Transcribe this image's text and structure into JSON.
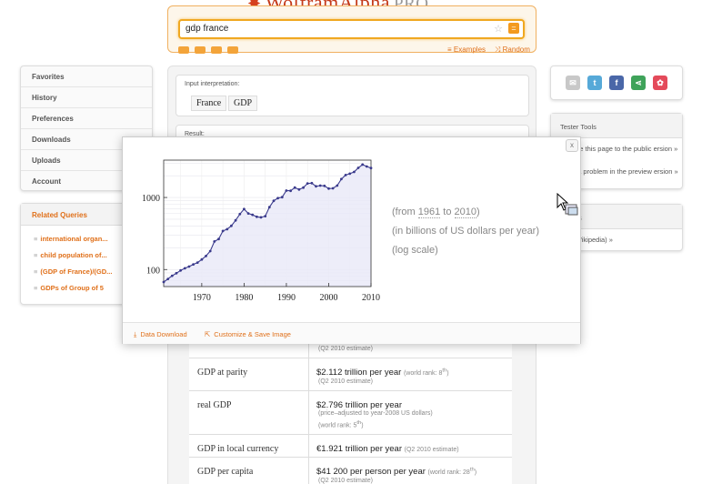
{
  "header": {
    "logo_text": "WolframAlpha",
    "logo_pro": "PRO",
    "search_value": "gdp france",
    "examples_label": "Examples",
    "random_label": "Random"
  },
  "left_nav": {
    "items": [
      "Favorites",
      "History",
      "Preferences",
      "Downloads",
      "Uploads",
      "Account"
    ]
  },
  "related_queries": {
    "title": "Related Queries",
    "items": [
      "international organ...",
      "child population of...",
      "(GDP of France)/(GD...",
      "GDPs of Group of 5"
    ]
  },
  "input_interpretation": {
    "label": "Input interpretation:",
    "parts": [
      "France",
      "GDP"
    ]
  },
  "result": {
    "label": "Result:"
  },
  "popup": {
    "close_label": "x",
    "notes": [
      "(from ",
      "1961",
      " to ",
      "2010",
      ")"
    ],
    "note_units": "(in billions of US dollars per year)",
    "note_scale": "(log scale)",
    "data_download_label": "Data Download",
    "customize_label": "Customize & Save Image"
  },
  "chart_data": {
    "type": "line",
    "title": "",
    "xlabel": "",
    "ylabel": "",
    "yscale": "log",
    "xlim": [
      1961,
      2010
    ],
    "ylim": [
      58,
      3300
    ],
    "x_ticks": [
      1970,
      1980,
      1990,
      2000,
      2010
    ],
    "y_ticks": [
      100,
      1000
    ],
    "grid": true,
    "x": [
      1961,
      1962,
      1963,
      1964,
      1965,
      1966,
      1967,
      1968,
      1969,
      1970,
      1971,
      1972,
      1973,
      1974,
      1975,
      1976,
      1977,
      1978,
      1979,
      1980,
      1981,
      1982,
      1983,
      1984,
      1985,
      1986,
      1987,
      1988,
      1989,
      1990,
      1991,
      1992,
      1993,
      1994,
      1995,
      1996,
      1997,
      1998,
      1999,
      2000,
      2001,
      2002,
      2003,
      2004,
      2005,
      2006,
      2007,
      2008,
      2009,
      2010
    ],
    "values": [
      67,
      74,
      82,
      89,
      97,
      104,
      110,
      118,
      125,
      138,
      154,
      180,
      245,
      265,
      343,
      363,
      404,
      482,
      589,
      690,
      600,
      575,
      540,
      530,
      550,
      735,
      900,
      980,
      1010,
      1245,
      1240,
      1370,
      1290,
      1370,
      1570,
      1580,
      1430,
      1460,
      1450,
      1330,
      1340,
      1460,
      1800,
      2050,
      2140,
      2260,
      2580,
      2860,
      2690,
      2560
    ]
  },
  "table": {
    "rows": [
      {
        "key": "",
        "value": "",
        "sub": "(Q2 2010 estimate)"
      },
      {
        "key": "GDP at parity",
        "value": "$2.112 trillion per year",
        "rank": "(world rank: 8",
        "rank_sup": "th",
        "rank_end": ")",
        "sub": "(Q2 2010 estimate)"
      },
      {
        "key": "real GDP",
        "value": "$2.796 trillion per year",
        "sub": "(price–adjusted to year-2008 US dollars)",
        "sub2": "(world rank: 5",
        "sub2_sup": "th",
        "sub2_end": ")"
      },
      {
        "key": "GDP in local currency",
        "value": "€1.921 trillion per year",
        "rank": "(Q2 2010 estimate)"
      },
      {
        "key": "GDP per capita",
        "value": "$41 200 per person per year",
        "rank": "(world rank: 28",
        "rank_sup": "th",
        "rank_end": ")",
        "sub": "(Q2 2010 estimate)"
      }
    ]
  },
  "right": {
    "tester_title": "Tester Tools",
    "tester_item1": "ompare this page to the public ersion »",
    "tester_item2": "eport a problem in the preview ersion »",
    "related_title": "d Links",
    "related_item": "nce (Wikipedia) »"
  },
  "colors": {
    "accent": "#e0701a",
    "line": "#3a3a8c",
    "area": "#e8e8f8"
  }
}
